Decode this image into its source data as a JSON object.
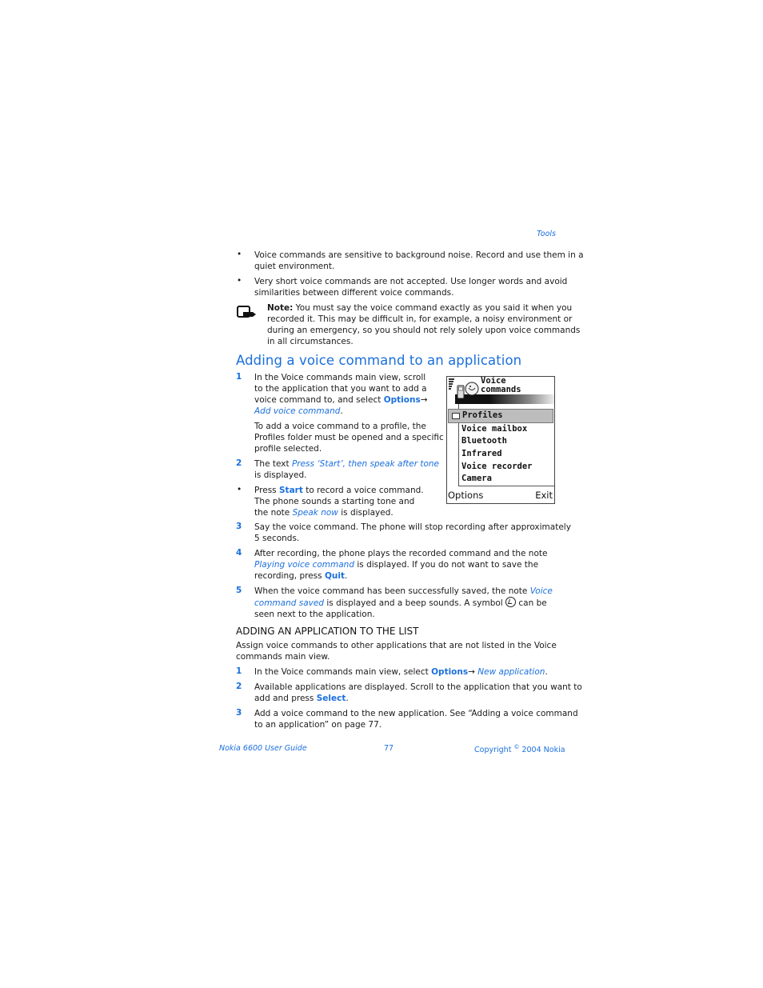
{
  "header": {
    "section": "Tools"
  },
  "bullets_top": [
    {
      "lines": [
        "Voice commands are sensitive to background noise. Record and use them in a",
        "quiet environment."
      ]
    },
    {
      "lines": [
        "Very short voice commands are not accepted. Use longer words and avoid",
        "similarities between different voice commands."
      ]
    }
  ],
  "note": {
    "label": "Note:",
    "line1": " You must say the voice command exactly as you said it when you",
    "line2": "recorded it. This may be difficult in, for example, a noisy environment or",
    "line3": "during an emergency, so you should not rely solely upon voice commands",
    "line4": "in all circumstances."
  },
  "section1": {
    "title": "Adding a voice command to an application",
    "step1": {
      "num": "1",
      "l1": "In the Voice commands main view, scroll",
      "l2": "to the application that you want to add a",
      "l3a": "voice command to, and select ",
      "l3b": "Options",
      "l3c": "→",
      "l4a": "Add voice command",
      "l4b": ".",
      "p1": "To add a voice command to a profile, the",
      "p2": "Profiles folder must be opened and a specific",
      "p3": "profile selected."
    },
    "step2": {
      "num": "2",
      "l1a": "The text ",
      "l1b": "Press ‘Start’, then speak after tone",
      "l2": "is displayed."
    },
    "bullet": {
      "l1a": "Press ",
      "l1b": "Start",
      "l1c": " to record a voice command.",
      "l2": "The phone sounds a starting tone and",
      "l3a": "the note ",
      "l3b": "Speak now",
      "l3c": " is displayed."
    },
    "step3": {
      "num": "3",
      "l1": "Say the voice command. The phone will stop recording after approximately",
      "l2": "5 seconds."
    },
    "step4": {
      "num": "4",
      "l1": "After recording, the phone plays the recorded command and the note",
      "l2a": "Playing voice command",
      "l2b": " is displayed. If you do not want to save the",
      "l3a": "recording, press ",
      "l3b": "Quit",
      "l3c": "."
    },
    "step5": {
      "num": "5",
      "l1a": "When the voice command has been successfully saved, the note ",
      "l1b": "Voice",
      "l2a": "command saved",
      "l2b": " is displayed and a beep sounds. A symbol ",
      "l2c": " can be",
      "l3": "seen next to the application."
    }
  },
  "phone_screen": {
    "title_line1": "Voice",
    "title_line2": "commands",
    "items": [
      "Profiles",
      "Voice mailbox",
      "Bluetooth",
      "Infrared",
      "Voice recorder",
      "Camera"
    ],
    "selected_index": 0,
    "left_softkey": "Options",
    "right_softkey": "Exit"
  },
  "section2": {
    "title": "ADDING AN APPLICATION TO THE LIST",
    "intro1": "Assign voice commands to other applications that are not listed in the Voice",
    "intro2": "commands main view.",
    "step1": {
      "num": "1",
      "l1a": "In the Voice commands main view, select ",
      "l1b": "Options",
      "l1c": "→ ",
      "l1d": "New application",
      "l1e": "."
    },
    "step2": {
      "num": "2",
      "l1": "Available applications are displayed. Scroll to the application that you want to",
      "l2a": "add and press ",
      "l2b": "Select",
      "l2c": "."
    },
    "step3": {
      "num": "3",
      "l1": "Add a voice command to the new application. See “Adding a voice command",
      "l2": "to an application” on page 77."
    }
  },
  "footer": {
    "left": "Nokia 6600 User Guide",
    "page": "77",
    "right_a": "Copyright ",
    "right_sup": "©",
    "right_b": " 2004 Nokia"
  }
}
